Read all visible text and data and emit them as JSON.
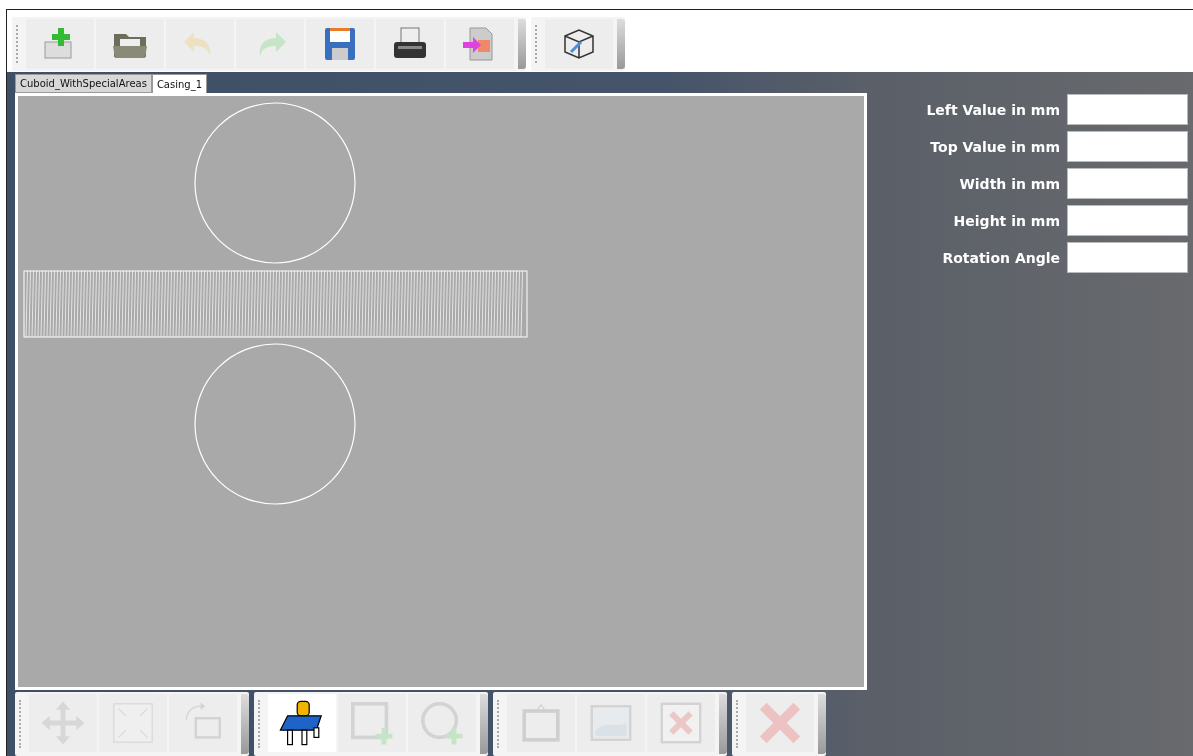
{
  "top_toolbars": [
    {
      "buttons": [
        {
          "kind": "new",
          "disabled": false
        },
        {
          "kind": "open",
          "disabled": false
        },
        {
          "kind": "undo",
          "disabled": true
        },
        {
          "kind": "redo",
          "disabled": true
        },
        {
          "kind": "save",
          "disabled": false
        },
        {
          "kind": "print",
          "disabled": false
        },
        {
          "kind": "export",
          "disabled": false
        }
      ]
    },
    {
      "buttons": [
        {
          "kind": "cube",
          "disabled": false
        }
      ]
    }
  ],
  "tabs": [
    {
      "label": "Cuboid_WithSpecialAreas",
      "selected": false
    },
    {
      "label": "Casing_1",
      "selected": true
    }
  ],
  "canvas": {
    "shapes": [
      {
        "kind": "circle"
      },
      {
        "kind": "hatched-rectangle"
      },
      {
        "kind": "circle"
      }
    ]
  },
  "bottom_toolbars": [
    {
      "buttons": [
        {
          "kind": "move",
          "disabled": true
        },
        {
          "kind": "resize",
          "disabled": true
        },
        {
          "kind": "rotate",
          "disabled": true
        }
      ]
    },
    {
      "buttons": [
        {
          "kind": "device",
          "disabled": false
        },
        {
          "kind": "add-rectangle",
          "disabled": true
        },
        {
          "kind": "add-circle",
          "disabled": true
        }
      ]
    },
    {
      "buttons": [
        {
          "kind": "frame",
          "disabled": true
        },
        {
          "kind": "image",
          "disabled": true
        },
        {
          "kind": "remove",
          "disabled": true
        }
      ]
    },
    {
      "buttons": [
        {
          "kind": "delete",
          "disabled": true
        }
      ]
    }
  ],
  "properties": [
    {
      "label": "Left Value in mm"
    },
    {
      "label": "Top Value in mm"
    },
    {
      "label": "Width in mm"
    },
    {
      "label": "Height in mm"
    },
    {
      "label": "Rotation Angle"
    }
  ]
}
